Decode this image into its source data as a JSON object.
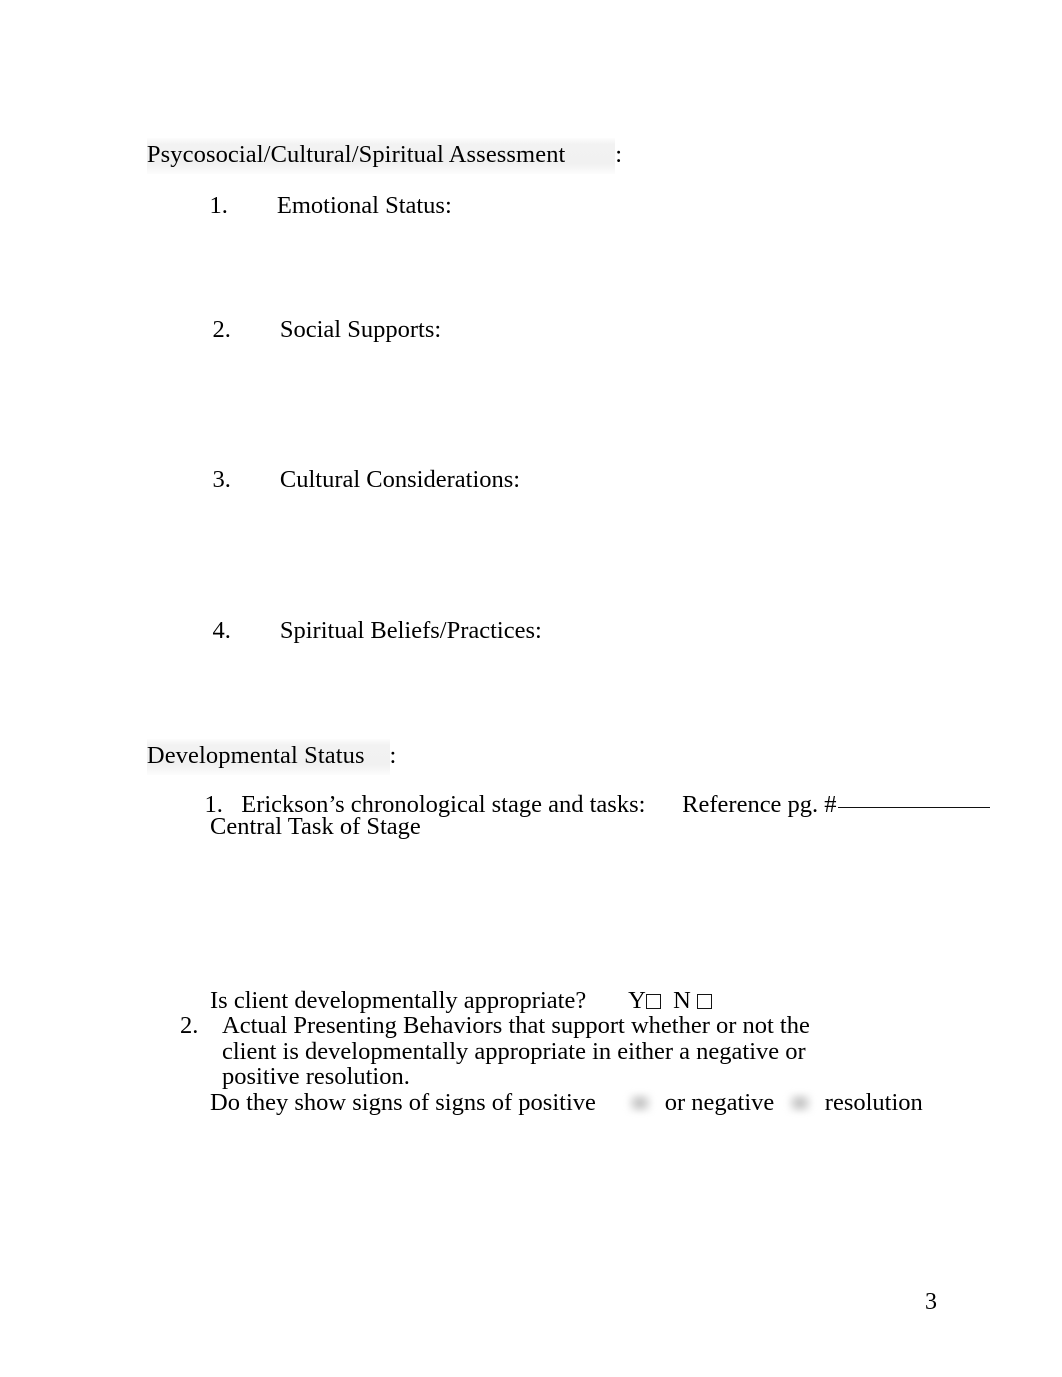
{
  "document": {
    "page_number": "3"
  },
  "sections": [
    {
      "heading": "Psycosocial/Cultural/Spiritual Assessment",
      "heading_colon": ":",
      "items": [
        {
          "number": "1.",
          "label": "Emotional Status:"
        },
        {
          "number": "2.",
          "label": "Social Supports:"
        },
        {
          "number": "3.",
          "label": "Cultural Considerations:"
        },
        {
          "number": "4.",
          "label": "Spiritual Beliefs/Practices:"
        }
      ]
    },
    {
      "heading": "Developmental Status",
      "heading_colon": ":",
      "item1": {
        "number": "1.",
        "label": "Erickson’s chronological stage and tasks:",
        "reference_label": "Reference pg. #",
        "reference_value": "",
        "subline": "Central Task of Stage"
      },
      "question": {
        "prompt": "Is client developmentally appropriate?",
        "yes_label": "Y",
        "no_label": "N",
        "second_prompt": "Do they show signs of signs of positive",
        "mid_text": "or negative",
        "end_text": "resolution"
      },
      "item2": {
        "number": "2.",
        "text": "Actual Presenting Behaviors that support whether or not the client is developmentally appropriate in either a negative or positive resolution."
      }
    }
  ],
  "colors": {
    "text": "#000000",
    "heading_shade": "#f1f1f1",
    "page_background": "#ffffff"
  }
}
